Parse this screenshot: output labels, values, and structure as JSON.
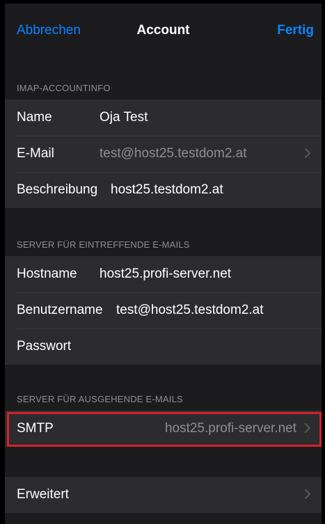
{
  "nav": {
    "cancel": "Abbrechen",
    "title": "Account",
    "done": "Fertig"
  },
  "sections": {
    "imap": {
      "header": "IMAP-ACCOUNTINFO",
      "name_label": "Name",
      "name_value": "Oja Test",
      "email_label": "E-Mail",
      "email_value": "test@host25.testdom2.at",
      "desc_label": "Beschreibung",
      "desc_value": "host25.testdom2.at"
    },
    "incoming": {
      "header": "SERVER FÜR EINTREFFENDE E-MAILS",
      "host_label": "Hostname",
      "host_value": "host25.profi-server.net",
      "user_label": "Benutzername",
      "user_value": "test@host25.testdom2.at",
      "pass_label": "Passwort"
    },
    "outgoing": {
      "header": "SERVER FÜR AUSGEHENDE E-MAILS",
      "smtp_label": "SMTP",
      "smtp_value": "host25.profi-server.net"
    },
    "advanced": {
      "label": "Erweitert"
    }
  },
  "colors": {
    "accent": "#0a84ff",
    "highlight": "#d6222b",
    "cell": "#2c2c2e",
    "background": "#1c1c1e"
  }
}
